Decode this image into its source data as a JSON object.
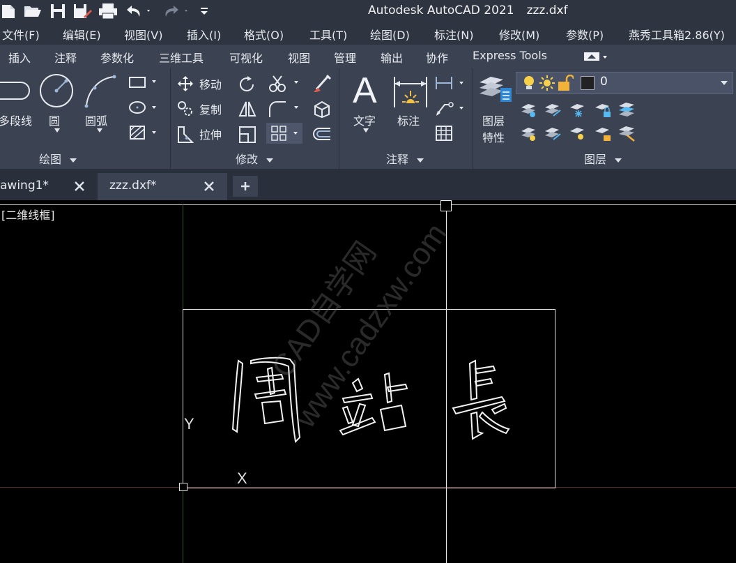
{
  "window": {
    "app_title": "Autodesk AutoCAD 2021",
    "file_title": "zzz.dxf"
  },
  "menu": [
    "文件(F)",
    "编辑(E)",
    "视图(V)",
    "插入(I)",
    "格式(O)",
    "工具(T)",
    "绘图(D)",
    "标注(N)",
    "修改(M)",
    "参数(P)",
    "燕秀工具箱2.86(Y)"
  ],
  "ribbon_tabs": [
    "插入",
    "注释",
    "参数化",
    "三维工具",
    "可视化",
    "视图",
    "管理",
    "输出",
    "协作",
    "Express Tools"
  ],
  "ribbon": {
    "draw": {
      "title": "绘图",
      "polyline": "多段线",
      "circle": "圆",
      "arc": "圆弧"
    },
    "modify": {
      "title": "修改",
      "move": "移动",
      "copy": "复制",
      "stretch": "拉伸"
    },
    "annotation": {
      "title": "注释",
      "text": "文字",
      "dimension": "标注",
      "text_glyph": "A"
    },
    "layers": {
      "title": "图层",
      "layer_props_line1": "图层",
      "layer_props_line2": "特性",
      "current_layer": "0"
    }
  },
  "doc_tabs": [
    "awing1*",
    "zzz.dxf*"
  ],
  "viewport": {
    "label": "[二维线框]",
    "y_axis": "Y",
    "x_axis": "X"
  },
  "drawing": {
    "chars": [
      "周",
      "站",
      "長"
    ]
  },
  "watermark": {
    "line1": "CAD自学网",
    "line2": "www.cadzxw.com"
  }
}
